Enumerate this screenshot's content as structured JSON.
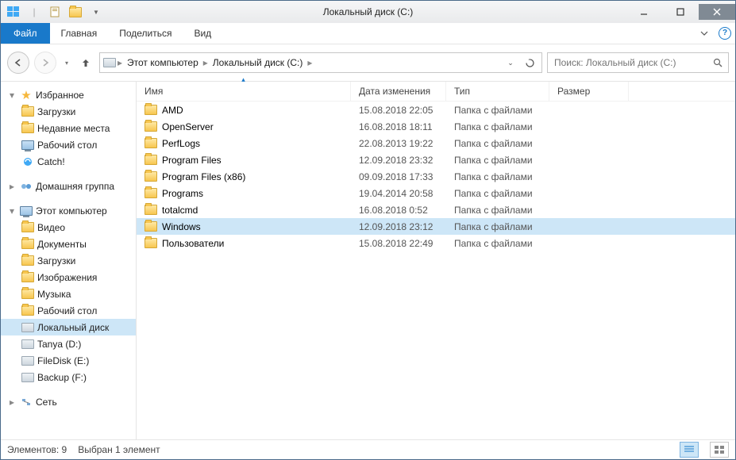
{
  "titlebar": {
    "title": "Локальный диск (C:)"
  },
  "ribbon": {
    "file": "Файл",
    "tabs": [
      "Главная",
      "Поделиться",
      "Вид"
    ]
  },
  "breadcrumbs": [
    {
      "label": "Этот компьютер",
      "icon": "pc"
    },
    {
      "label": "Локальный диск (C:)",
      "icon": null
    }
  ],
  "search": {
    "placeholder": "Поиск: Локальный диск (C:)",
    "value": ""
  },
  "nav": {
    "favorites": {
      "label": "Избранное",
      "items": [
        {
          "label": "Загрузки",
          "icon": "folder"
        },
        {
          "label": "Недавние места",
          "icon": "folder"
        },
        {
          "label": "Рабочий стол",
          "icon": "pc"
        },
        {
          "label": "Catch!",
          "icon": "catch"
        }
      ]
    },
    "homegroup": {
      "label": "Домашняя группа"
    },
    "computer": {
      "label": "Этот компьютер",
      "items": [
        {
          "label": "Видео",
          "icon": "folder"
        },
        {
          "label": "Документы",
          "icon": "folder"
        },
        {
          "label": "Загрузки",
          "icon": "folder"
        },
        {
          "label": "Изображения",
          "icon": "folder"
        },
        {
          "label": "Музыка",
          "icon": "folder"
        },
        {
          "label": "Рабочий стол",
          "icon": "folder"
        },
        {
          "label": "Локальный диск",
          "icon": "drive",
          "selected": true
        },
        {
          "label": "Tanya (D:)",
          "icon": "drive"
        },
        {
          "label": "FileDisk (E:)",
          "icon": "drive"
        },
        {
          "label": "Backup (F:)",
          "icon": "drive"
        }
      ]
    },
    "network": {
      "label": "Сеть"
    }
  },
  "columns": {
    "name": "Имя",
    "date": "Дата изменения",
    "type": "Тип",
    "size": "Размер",
    "sort": "name",
    "dir": "asc"
  },
  "files": [
    {
      "name": "AMD",
      "date": "15.08.2018 22:05",
      "type": "Папка с файлами",
      "size": ""
    },
    {
      "name": "OpenServer",
      "date": "16.08.2018 18:11",
      "type": "Папка с файлами",
      "size": ""
    },
    {
      "name": "PerfLogs",
      "date": "22.08.2013 19:22",
      "type": "Папка с файлами",
      "size": ""
    },
    {
      "name": "Program Files",
      "date": "12.09.2018 23:32",
      "type": "Папка с файлами",
      "size": ""
    },
    {
      "name": "Program Files (x86)",
      "date": "09.09.2018 17:33",
      "type": "Папка с файлами",
      "size": ""
    },
    {
      "name": "Programs",
      "date": "19.04.2014 20:58",
      "type": "Папка с файлами",
      "size": ""
    },
    {
      "name": "totalcmd",
      "date": "16.08.2018 0:52",
      "type": "Папка с файлами",
      "size": ""
    },
    {
      "name": "Windows",
      "date": "12.09.2018 23:12",
      "type": "Папка с файлами",
      "size": "",
      "selected": true
    },
    {
      "name": "Пользователи",
      "date": "15.08.2018 22:49",
      "type": "Папка с файлами",
      "size": ""
    }
  ],
  "status": {
    "count_label": "Элементов: 9",
    "selection_label": "Выбран 1 элемент"
  }
}
